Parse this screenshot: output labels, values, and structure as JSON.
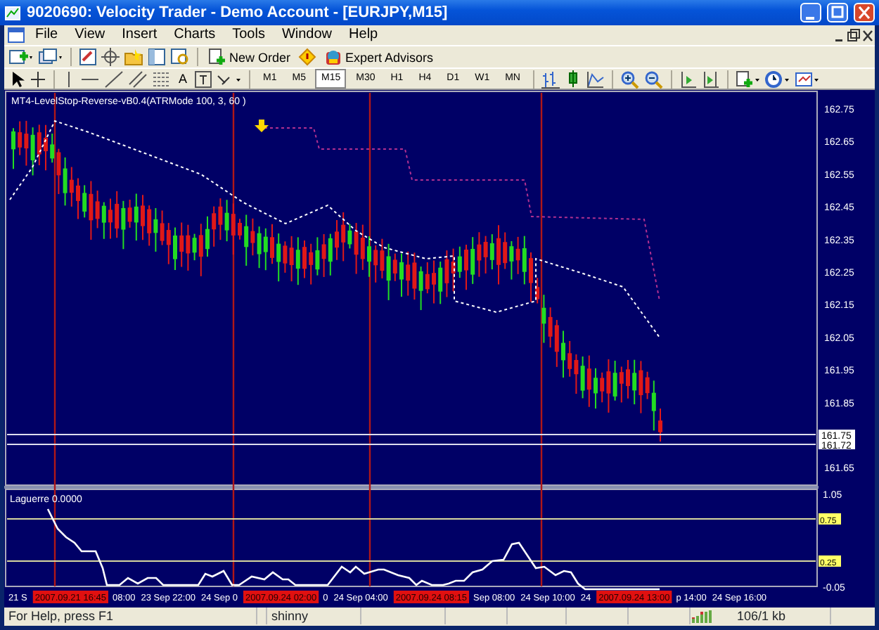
{
  "window": {
    "title": "9020690: Velocity Trader - Demo Account - [EURJPY,M15]"
  },
  "menu": [
    "File",
    "View",
    "Insert",
    "Charts",
    "Tools",
    "Window",
    "Help"
  ],
  "toolbar": {
    "new_order": "New Order",
    "expert_advisors": "Expert Advisors",
    "text_tool": "A",
    "timeframes": [
      {
        "label": "M1",
        "selected": false
      },
      {
        "label": "M5",
        "selected": false
      },
      {
        "label": "M15",
        "selected": true
      },
      {
        "label": "M30",
        "selected": false
      },
      {
        "label": "H1",
        "selected": false
      },
      {
        "label": "H4",
        "selected": false
      },
      {
        "label": "D1",
        "selected": false
      },
      {
        "label": "W1",
        "selected": false
      },
      {
        "label": "MN",
        "selected": false
      }
    ]
  },
  "chart": {
    "indicator_label": "MT4-LevelStop-Reverse-vB0.4(ATRMode 100, 3, 60 )",
    "price_axis": [
      "162.75",
      "162.65",
      "162.55",
      "162.45",
      "162.35",
      "162.25",
      "162.15",
      "162.05",
      "161.95",
      "161.85",
      "161.65"
    ],
    "price_tags": [
      "161.75",
      "161.72"
    ],
    "sub_window": {
      "label": "Laguerre 0.0000",
      "axis": [
        "1.05",
        "-0.05"
      ],
      "levels": [
        "0.75",
        "0.25"
      ]
    },
    "time_axis": [
      {
        "kind": "label",
        "text": "21 S"
      },
      {
        "kind": "marker",
        "text": "2007.09.21 16:45"
      },
      {
        "kind": "label",
        "text": "08:00"
      },
      {
        "kind": "label",
        "text": "23 Sep 22:00"
      },
      {
        "kind": "label",
        "text": "24 Sep 0"
      },
      {
        "kind": "marker",
        "text": "2007.09.24 02:00"
      },
      {
        "kind": "label",
        "text": "0"
      },
      {
        "kind": "label",
        "text": "24 Sep 04:00"
      },
      {
        "kind": "marker",
        "text": "2007.09.24 08:15"
      },
      {
        "kind": "label",
        "text": "Sep 08:00"
      },
      {
        "kind": "label",
        "text": "24 Sep 10:00"
      },
      {
        "kind": "label",
        "text": "24"
      },
      {
        "kind": "marker",
        "text": "2007.09.24 13:00"
      },
      {
        "kind": "label",
        "text": "p 14:00"
      },
      {
        "kind": "label",
        "text": "24 Sep 16:00"
      }
    ]
  },
  "status_bar": {
    "help": "For Help, press F1",
    "profile": "shinny",
    "traffic": "106/1 kb"
  }
}
